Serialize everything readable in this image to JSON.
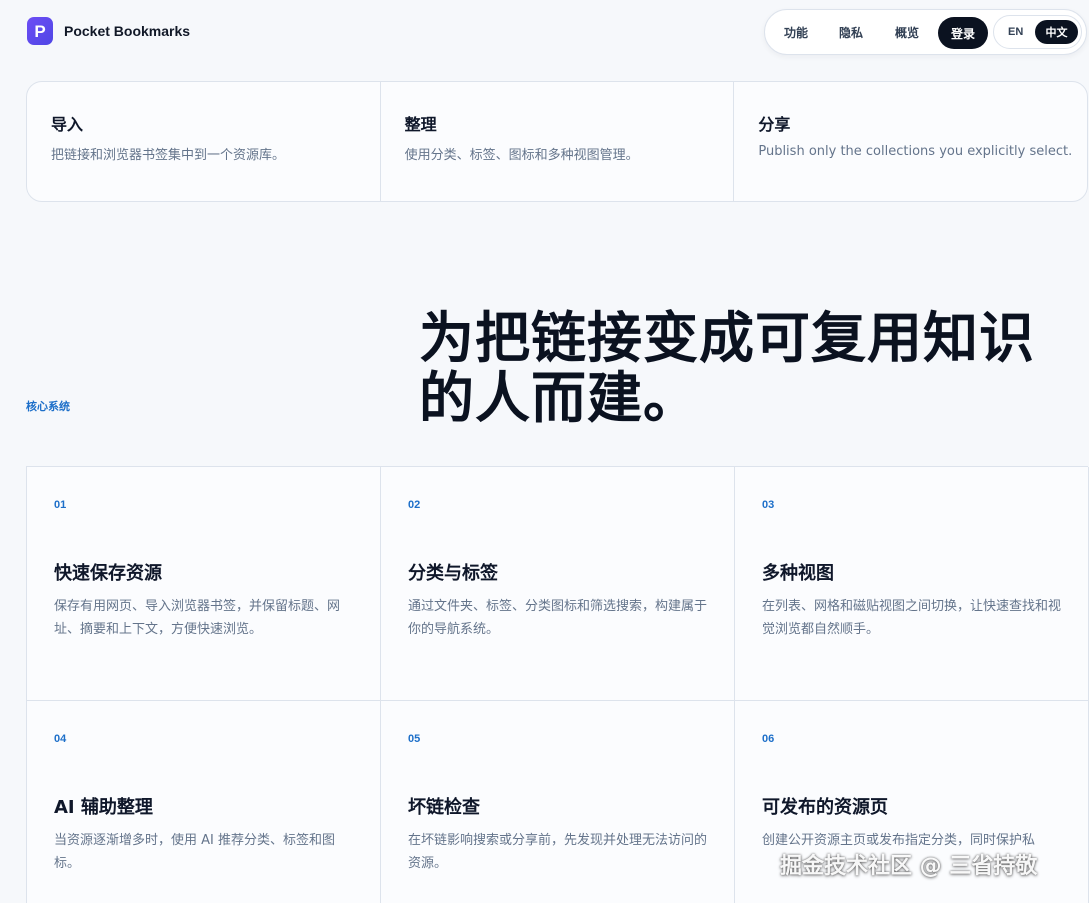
{
  "header": {
    "logo_glyph": "P",
    "brand_name": "Pocket Bookmarks",
    "nav": [
      {
        "label": "功能"
      },
      {
        "label": "隐私"
      },
      {
        "label": "概览"
      }
    ],
    "login_label": "登录",
    "lang": {
      "en": "EN",
      "zh": "中文"
    }
  },
  "top_cards": [
    {
      "title": "导入",
      "desc": "把链接和浏览器书签集中到一个资源库。"
    },
    {
      "title": "整理",
      "desc": "使用分类、标签、图标和多种视图管理。"
    },
    {
      "title": "分享",
      "desc": "Publish only the collections you explicitly select."
    }
  ],
  "section": {
    "label": "核心系统",
    "headline_line1": "为把链接变成可复用知识",
    "headline_line2": "的人而建。"
  },
  "features": [
    {
      "num": "01",
      "title": "快速保存资源",
      "desc": "保存有用网页、导入浏览器书签，并保留标题、网址、摘要和上下文，方便快速浏览。"
    },
    {
      "num": "02",
      "title": "分类与标签",
      "desc": "通过文件夹、标签、分类图标和筛选搜索，构建属于你的导航系统。"
    },
    {
      "num": "03",
      "title": "多种视图",
      "desc": "在列表、网格和磁贴视图之间切换，让快速查找和视觉浏览都自然顺手。"
    },
    {
      "num": "04",
      "title": "AI 辅助整理",
      "desc": "当资源逐渐增多时，使用 AI 推荐分类、标签和图标。"
    },
    {
      "num": "05",
      "title": "坏链检查",
      "desc": "在坏链影响搜索或分享前，先发现并处理无法访问的资源。"
    },
    {
      "num": "06",
      "title": "可发布的资源页",
      "desc": "创建公开资源主页或发布指定分类，同时保护私"
    }
  ],
  "watermark": "掘金技术社区 @ 三省持敬"
}
